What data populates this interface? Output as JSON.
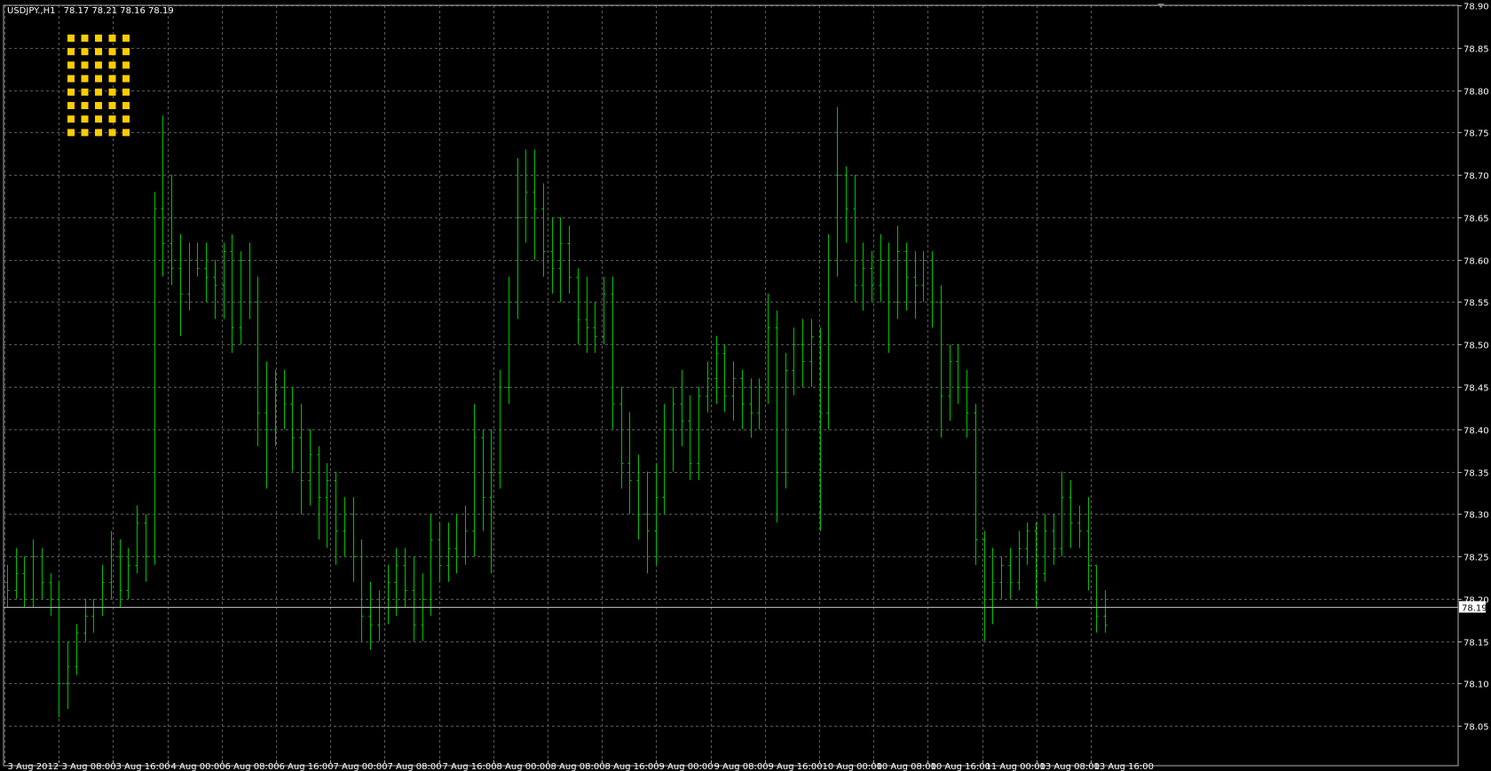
{
  "header": {
    "symbol": "USDJPY.,H1",
    "ohlc": "78.17 78.21 78.16 78.19"
  },
  "colors": {
    "background": "#000000",
    "grid": "#5a5a5a",
    "bar": "#00c000",
    "axis_text": "#ffffff",
    "bid_line": "#b8b8b8",
    "indicator": "#ffcc00"
  },
  "indicator_icon": "yellow-dot-grid-icon",
  "current_price": "78.19",
  "chart_data": {
    "type": "ohlc-bar",
    "title": "",
    "xlabel": "",
    "ylabel": "",
    "ylim": [
      78.0,
      78.9
    ],
    "grid": true,
    "y_ticks": [
      "78.05",
      "78.10",
      "78.15",
      "78.20",
      "78.25",
      "78.30",
      "78.35",
      "78.40",
      "78.45",
      "78.50",
      "78.55",
      "78.60",
      "78.65",
      "78.70",
      "78.75",
      "78.80",
      "78.85",
      "78.90"
    ],
    "x_ticks": [
      "3 Aug 2012",
      "3 Aug 08:00",
      "3 Aug 16:00",
      "4 Aug 00:00",
      "6 Aug 08:00",
      "6 Aug 16:00",
      "7 Aug 00:00",
      "7 Aug 08:00",
      "7 Aug 16:00",
      "8 Aug 00:00",
      "8 Aug 08:00",
      "8 Aug 16:00",
      "9 Aug 00:00",
      "9 Aug 08:00",
      "9 Aug 16:00",
      "10 Aug 00:00",
      "10 Aug 08:00",
      "10 Aug 16:00",
      "11 Aug 00:00",
      "13 Aug 08:00",
      "13 Aug 16:00"
    ],
    "bars": [
      [
        78.22,
        78.24,
        78.19,
        78.21
      ],
      [
        78.21,
        78.26,
        78.2,
        78.23
      ],
      [
        78.23,
        78.25,
        78.19,
        78.2
      ],
      [
        78.2,
        78.27,
        78.19,
        78.25
      ],
      [
        78.25,
        78.26,
        78.2,
        78.22
      ],
      [
        78.22,
        78.23,
        78.18,
        78.2
      ],
      [
        78.2,
        78.22,
        78.06,
        78.1
      ],
      [
        78.1,
        78.15,
        78.07,
        78.12
      ],
      [
        78.12,
        78.17,
        78.11,
        78.16
      ],
      [
        78.16,
        78.2,
        78.15,
        78.18
      ],
      [
        78.18,
        78.2,
        78.16,
        78.19
      ],
      [
        78.19,
        78.24,
        78.18,
        78.22
      ],
      [
        78.22,
        78.28,
        78.2,
        78.25
      ],
      [
        78.25,
        78.27,
        78.19,
        78.21
      ],
      [
        78.21,
        78.26,
        78.2,
        78.24
      ],
      [
        78.24,
        78.31,
        78.23,
        78.29
      ],
      [
        78.29,
        78.3,
        78.22,
        78.25
      ],
      [
        78.25,
        78.68,
        78.24,
        78.66
      ],
      [
        78.66,
        78.77,
        78.58,
        78.62
      ],
      [
        78.62,
        78.7,
        78.57,
        78.59
      ],
      [
        78.59,
        78.63,
        78.51,
        78.56
      ],
      [
        78.56,
        78.62,
        78.54,
        78.6
      ],
      [
        78.6,
        78.62,
        78.58,
        78.59
      ],
      [
        78.59,
        78.62,
        78.55,
        78.58
      ],
      [
        78.58,
        78.6,
        78.53,
        78.57
      ],
      [
        78.57,
        78.62,
        78.53,
        78.61
      ],
      [
        78.61,
        78.63,
        78.49,
        78.52
      ],
      [
        78.52,
        78.61,
        78.5,
        78.6
      ],
      [
        78.6,
        78.62,
        78.53,
        78.55
      ],
      [
        78.55,
        78.58,
        78.38,
        78.42
      ],
      [
        78.42,
        78.48,
        78.33,
        78.4
      ],
      [
        78.4,
        78.47,
        78.38,
        78.45
      ],
      [
        78.45,
        78.47,
        78.4,
        78.43
      ],
      [
        78.43,
        78.45,
        78.35,
        78.39
      ],
      [
        78.39,
        78.43,
        78.3,
        78.34
      ],
      [
        78.34,
        78.4,
        78.31,
        78.37
      ],
      [
        78.37,
        78.38,
        78.27,
        78.32
      ],
      [
        78.32,
        78.36,
        78.26,
        78.34
      ],
      [
        78.34,
        78.35,
        78.24,
        78.28
      ],
      [
        78.28,
        78.32,
        78.25,
        78.3
      ],
      [
        78.3,
        78.32,
        78.22,
        78.25
      ],
      [
        78.25,
        78.27,
        78.15,
        78.18
      ],
      [
        78.18,
        78.22,
        78.14,
        78.17
      ],
      [
        78.17,
        78.21,
        78.15,
        78.19
      ],
      [
        78.19,
        78.24,
        78.17,
        78.22
      ],
      [
        78.22,
        78.26,
        78.18,
        78.24
      ],
      [
        78.24,
        78.26,
        78.19,
        78.21
      ],
      [
        78.21,
        78.25,
        78.15,
        78.17
      ],
      [
        78.17,
        78.23,
        78.15,
        78.2
      ],
      [
        78.2,
        78.3,
        78.18,
        78.27
      ],
      [
        78.27,
        78.29,
        78.22,
        78.24
      ],
      [
        78.24,
        78.29,
        78.22,
        78.26
      ],
      [
        78.26,
        78.3,
        78.23,
        78.25
      ],
      [
        78.25,
        78.31,
        78.24,
        78.28
      ],
      [
        78.28,
        78.43,
        78.25,
        78.39
      ],
      [
        78.39,
        78.4,
        78.28,
        78.32
      ],
      [
        78.32,
        78.4,
        78.23,
        78.35
      ],
      [
        78.35,
        78.47,
        78.33,
        78.45
      ],
      [
        78.45,
        78.58,
        78.43,
        78.55
      ],
      [
        78.55,
        78.72,
        78.53,
        78.65
      ],
      [
        78.65,
        78.73,
        78.62,
        78.68
      ],
      [
        78.68,
        78.73,
        78.6,
        78.66
      ],
      [
        78.66,
        78.69,
        78.58,
        78.61
      ],
      [
        78.61,
        78.65,
        78.56,
        78.59
      ],
      [
        78.59,
        78.65,
        78.55,
        78.62
      ],
      [
        78.62,
        78.64,
        78.56,
        78.58
      ],
      [
        78.58,
        78.59,
        78.5,
        78.53
      ],
      [
        78.53,
        78.58,
        78.49,
        78.52
      ],
      [
        78.52,
        78.55,
        78.49,
        78.51
      ],
      [
        78.51,
        78.58,
        78.5,
        78.56
      ],
      [
        78.56,
        78.58,
        78.4,
        78.43
      ],
      [
        78.43,
        78.45,
        78.33,
        78.36
      ],
      [
        78.36,
        78.42,
        78.3,
        78.34
      ],
      [
        78.34,
        78.37,
        78.27,
        78.3
      ],
      [
        78.3,
        78.35,
        78.23,
        78.28
      ],
      [
        78.28,
        78.36,
        78.24,
        78.32
      ],
      [
        78.32,
        78.43,
        78.3,
        78.4
      ],
      [
        78.4,
        78.45,
        78.35,
        78.43
      ],
      [
        78.43,
        78.47,
        78.38,
        78.41
      ],
      [
        78.41,
        78.44,
        78.34,
        78.36
      ],
      [
        78.36,
        78.45,
        78.34,
        78.44
      ],
      [
        78.44,
        78.48,
        78.42,
        78.46
      ],
      [
        78.46,
        78.51,
        78.43,
        78.49
      ],
      [
        78.49,
        78.5,
        78.42,
        78.44
      ],
      [
        78.44,
        78.48,
        78.41,
        78.46
      ],
      [
        78.46,
        78.47,
        78.4,
        78.43
      ],
      [
        78.43,
        78.46,
        78.39,
        78.42
      ],
      [
        78.42,
        78.46,
        78.4,
        78.45
      ],
      [
        78.45,
        78.56,
        78.43,
        78.52
      ],
      [
        78.52,
        78.54,
        78.29,
        78.35
      ],
      [
        78.35,
        78.49,
        78.33,
        78.47
      ],
      [
        78.47,
        78.52,
        78.44,
        78.5
      ],
      [
        78.5,
        78.53,
        78.45,
        78.48
      ],
      [
        78.48,
        78.53,
        78.45,
        78.51
      ],
      [
        78.51,
        78.52,
        78.28,
        78.42
      ],
      [
        78.42,
        78.63,
        78.4,
        78.6
      ],
      [
        78.6,
        78.78,
        78.58,
        78.7
      ],
      [
        78.7,
        78.71,
        78.62,
        78.66
      ],
      [
        78.66,
        78.7,
        78.55,
        78.57
      ],
      [
        78.57,
        78.62,
        78.54,
        78.59
      ],
      [
        78.59,
        78.61,
        78.55,
        78.57
      ],
      [
        78.57,
        78.63,
        78.55,
        78.6
      ],
      [
        78.6,
        78.62,
        78.49,
        78.55
      ],
      [
        78.55,
        78.64,
        78.53,
        78.61
      ],
      [
        78.61,
        78.62,
        78.54,
        78.58
      ],
      [
        78.58,
        78.61,
        78.53,
        78.57
      ],
      [
        78.57,
        78.61,
        78.55,
        78.6
      ],
      [
        78.6,
        78.61,
        78.52,
        78.55
      ],
      [
        78.55,
        78.57,
        78.39,
        78.44
      ],
      [
        78.44,
        78.5,
        78.41,
        78.48
      ],
      [
        78.48,
        78.5,
        78.43,
        78.45
      ],
      [
        78.45,
        78.47,
        78.39,
        78.42
      ],
      [
        78.42,
        78.43,
        78.24,
        78.27
      ],
      [
        78.27,
        78.28,
        78.15,
        78.2
      ],
      [
        78.2,
        78.26,
        78.17,
        78.22
      ],
      [
        78.22,
        78.25,
        78.2,
        78.24
      ],
      [
        78.24,
        78.26,
        78.2,
        78.22
      ],
      [
        78.22,
        78.28,
        78.21,
        78.26
      ],
      [
        78.26,
        78.29,
        78.24,
        78.28
      ],
      [
        78.28,
        78.29,
        78.19,
        78.23
      ],
      [
        78.23,
        78.3,
        78.22,
        78.28
      ],
      [
        78.28,
        78.3,
        78.24,
        78.26
      ],
      [
        78.26,
        78.35,
        78.25,
        78.32
      ],
      [
        78.32,
        78.34,
        78.26,
        78.29
      ],
      [
        78.29,
        78.31,
        78.26,
        78.28
      ],
      [
        78.28,
        78.32,
        78.21,
        78.24
      ],
      [
        78.24,
        78.24,
        78.16,
        78.18
      ],
      [
        78.18,
        78.21,
        78.16,
        78.17
      ]
    ]
  }
}
